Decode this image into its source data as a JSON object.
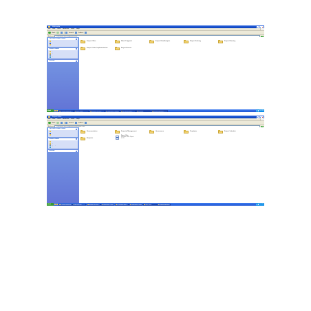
{
  "colors": {
    "title_bar": "#0a3fb8",
    "task_pane": "#6375d6",
    "folder": "#f5d672",
    "taskbar": "#1f55d2",
    "start_button": "#3a9b32"
  },
  "screens": [
    {
      "window_title": "Multimedia",
      "menu": [
        "File",
        "Edit",
        "View",
        "Favorites",
        "Tools",
        "Help"
      ],
      "toolbar": {
        "back_label": "Back",
        "search_label": "Search",
        "folders_label": "Folders"
      },
      "address": {
        "label": "Address",
        "value": "C:\\Documents and Settings\\Multimedia",
        "go_label": "Go"
      },
      "tasks": [
        {
          "title": "File and Folder Tasks",
          "items": [
            "Make a new folder",
            "Publish this folder to the Web",
            "Share this folder"
          ]
        },
        {
          "title": "Other Places",
          "items": [
            "My Documents",
            "My Documents",
            "Shared Documents",
            "My Network Places"
          ]
        },
        {
          "title": "Details",
          "items": []
        }
      ],
      "items": [
        {
          "label": "Project Office",
          "kind": "folder"
        },
        {
          "label": "Week 1 Agenda",
          "kind": "folder"
        },
        {
          "label": "Project Data Analysis",
          "kind": "folder"
        },
        {
          "label": "Project Tracking",
          "kind": "folder"
        },
        {
          "label": "Project Planning",
          "kind": "folder"
        },
        {
          "label": "Project Online Implementation",
          "kind": "folder"
        },
        {
          "label": "Project Process",
          "kind": "folder"
        }
      ],
      "taskbar": {
        "start_label": "start",
        "buttons": [
          "4 Certified Implement...",
          "How to do last",
          "Windows Office mw...",
          "Presentations - Microsoft",
          "Cat_Microsoft Word...",
          "Multimedia",
          "Microsoft PowerPoint..."
        ],
        "active_index": 5,
        "clock": "2:21 PM"
      }
    },
    {
      "window_title": "Project Office",
      "menu": [
        "File",
        "Edit",
        "View",
        "Favorites",
        "Tools",
        "Help"
      ],
      "toolbar": {
        "back_label": "Back",
        "search_label": "Search",
        "folders_label": "Folders"
      },
      "address": {
        "label": "Address",
        "value": "C:\\Documents and Settings\\Multimedia\\Project Office",
        "go_label": "Go"
      },
      "tasks": [
        {
          "title": "File and Folder Tasks",
          "items": [
            "Make a new folder",
            "Publish this folder to the Web",
            "Share this folder"
          ]
        },
        {
          "title": "Other Places",
          "items": [
            "Multimedia",
            "My Documents",
            "My Computer",
            "My Network Places"
          ]
        },
        {
          "title": "Details",
          "items": []
        }
      ],
      "items": [
        {
          "label": "Documentation",
          "kind": "folder"
        },
        {
          "label": "Financial Management",
          "kind": "folder"
        },
        {
          "label": "Governance",
          "kind": "folder"
        },
        {
          "label": "Templates",
          "kind": "folder"
        },
        {
          "label": "Project Schedule",
          "kind": "folder"
        },
        {
          "label": "Requests",
          "kind": "folder"
        },
        {
          "label": "Project Office",
          "kind": "file",
          "sub1": "Microsoft Office Project",
          "sub2": "47 KB"
        }
      ],
      "taskbar": {
        "start_label": "start",
        "buttons": [
          "4 Certified Implement...",
          "How to do last",
          "Windows Office mw...",
          "Presentations - Microsoft",
          "Cat_Microsoft Word...",
          "Presentations - Project",
          "Project Office",
          "Microsoft PowerPoint..."
        ],
        "active_index": 6,
        "clock": "2:22 PM"
      }
    }
  ]
}
